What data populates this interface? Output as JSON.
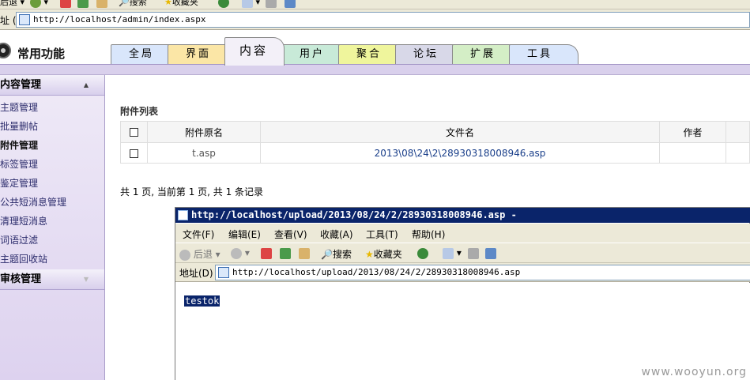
{
  "outer_browser": {
    "toolbar": {
      "back_label": "后退",
      "search_label": "搜索",
      "favorites_label": "收藏夹"
    },
    "address": {
      "label": "址 (D)",
      "url": "http://localhost/admin/index.aspx"
    }
  },
  "header": {
    "title": "常用功能",
    "tabs": [
      {
        "label": "全局",
        "color": "#d9e6fb"
      },
      {
        "label": "界面",
        "color": "#fbe6a6"
      },
      {
        "label": "内容",
        "color": "#f3f0f8"
      },
      {
        "label": "用户",
        "color": "#c8ead8"
      },
      {
        "label": "聚合",
        "color": "#eff59c"
      },
      {
        "label": "论坛",
        "color": "#d8d8e8"
      },
      {
        "label": "扩展",
        "color": "#d4eec6"
      },
      {
        "label": "工具",
        "color": "#d9e6fb"
      }
    ],
    "active_tab": "内容"
  },
  "sidebar": {
    "group1": "内容管理",
    "items": [
      {
        "label": "主题管理",
        "active": false
      },
      {
        "label": "批量删帖",
        "active": false
      },
      {
        "label": "附件管理",
        "active": true
      },
      {
        "label": "标签管理",
        "active": false
      },
      {
        "label": "鉴定管理",
        "active": false
      },
      {
        "label": "公共短消息管理",
        "active": false
      },
      {
        "label": "清理短消息",
        "active": false
      },
      {
        "label": "词语过滤",
        "active": false
      },
      {
        "label": "主题回收站",
        "active": false
      }
    ],
    "group2": "审核管理"
  },
  "main": {
    "section_title": "附件列表",
    "columns": [
      "附件原名",
      "文件名",
      "作者"
    ],
    "rows": [
      {
        "original_name": "t.asp",
        "file_name": "2013\\08\\24\\2\\28930318008946.asp",
        "author": ""
      }
    ],
    "pager": "共 1 页, 当前第 1 页, 共 1 条记录"
  },
  "popup": {
    "title": "http://localhost/upload/2013/08/24/2/28930318008946.asp -",
    "menus": [
      "文件(F)",
      "编辑(E)",
      "查看(V)",
      "收藏(A)",
      "工具(T)",
      "帮助(H)"
    ],
    "toolbar": {
      "back_label": "后退",
      "search_label": "搜索",
      "favorites_label": "收藏夹"
    },
    "address": {
      "label": "地址(D)",
      "url": "http://localhost/upload/2013/08/24/2/28930318008946.asp"
    },
    "body_text": "testok"
  },
  "watermark": "www.wooyun.org"
}
